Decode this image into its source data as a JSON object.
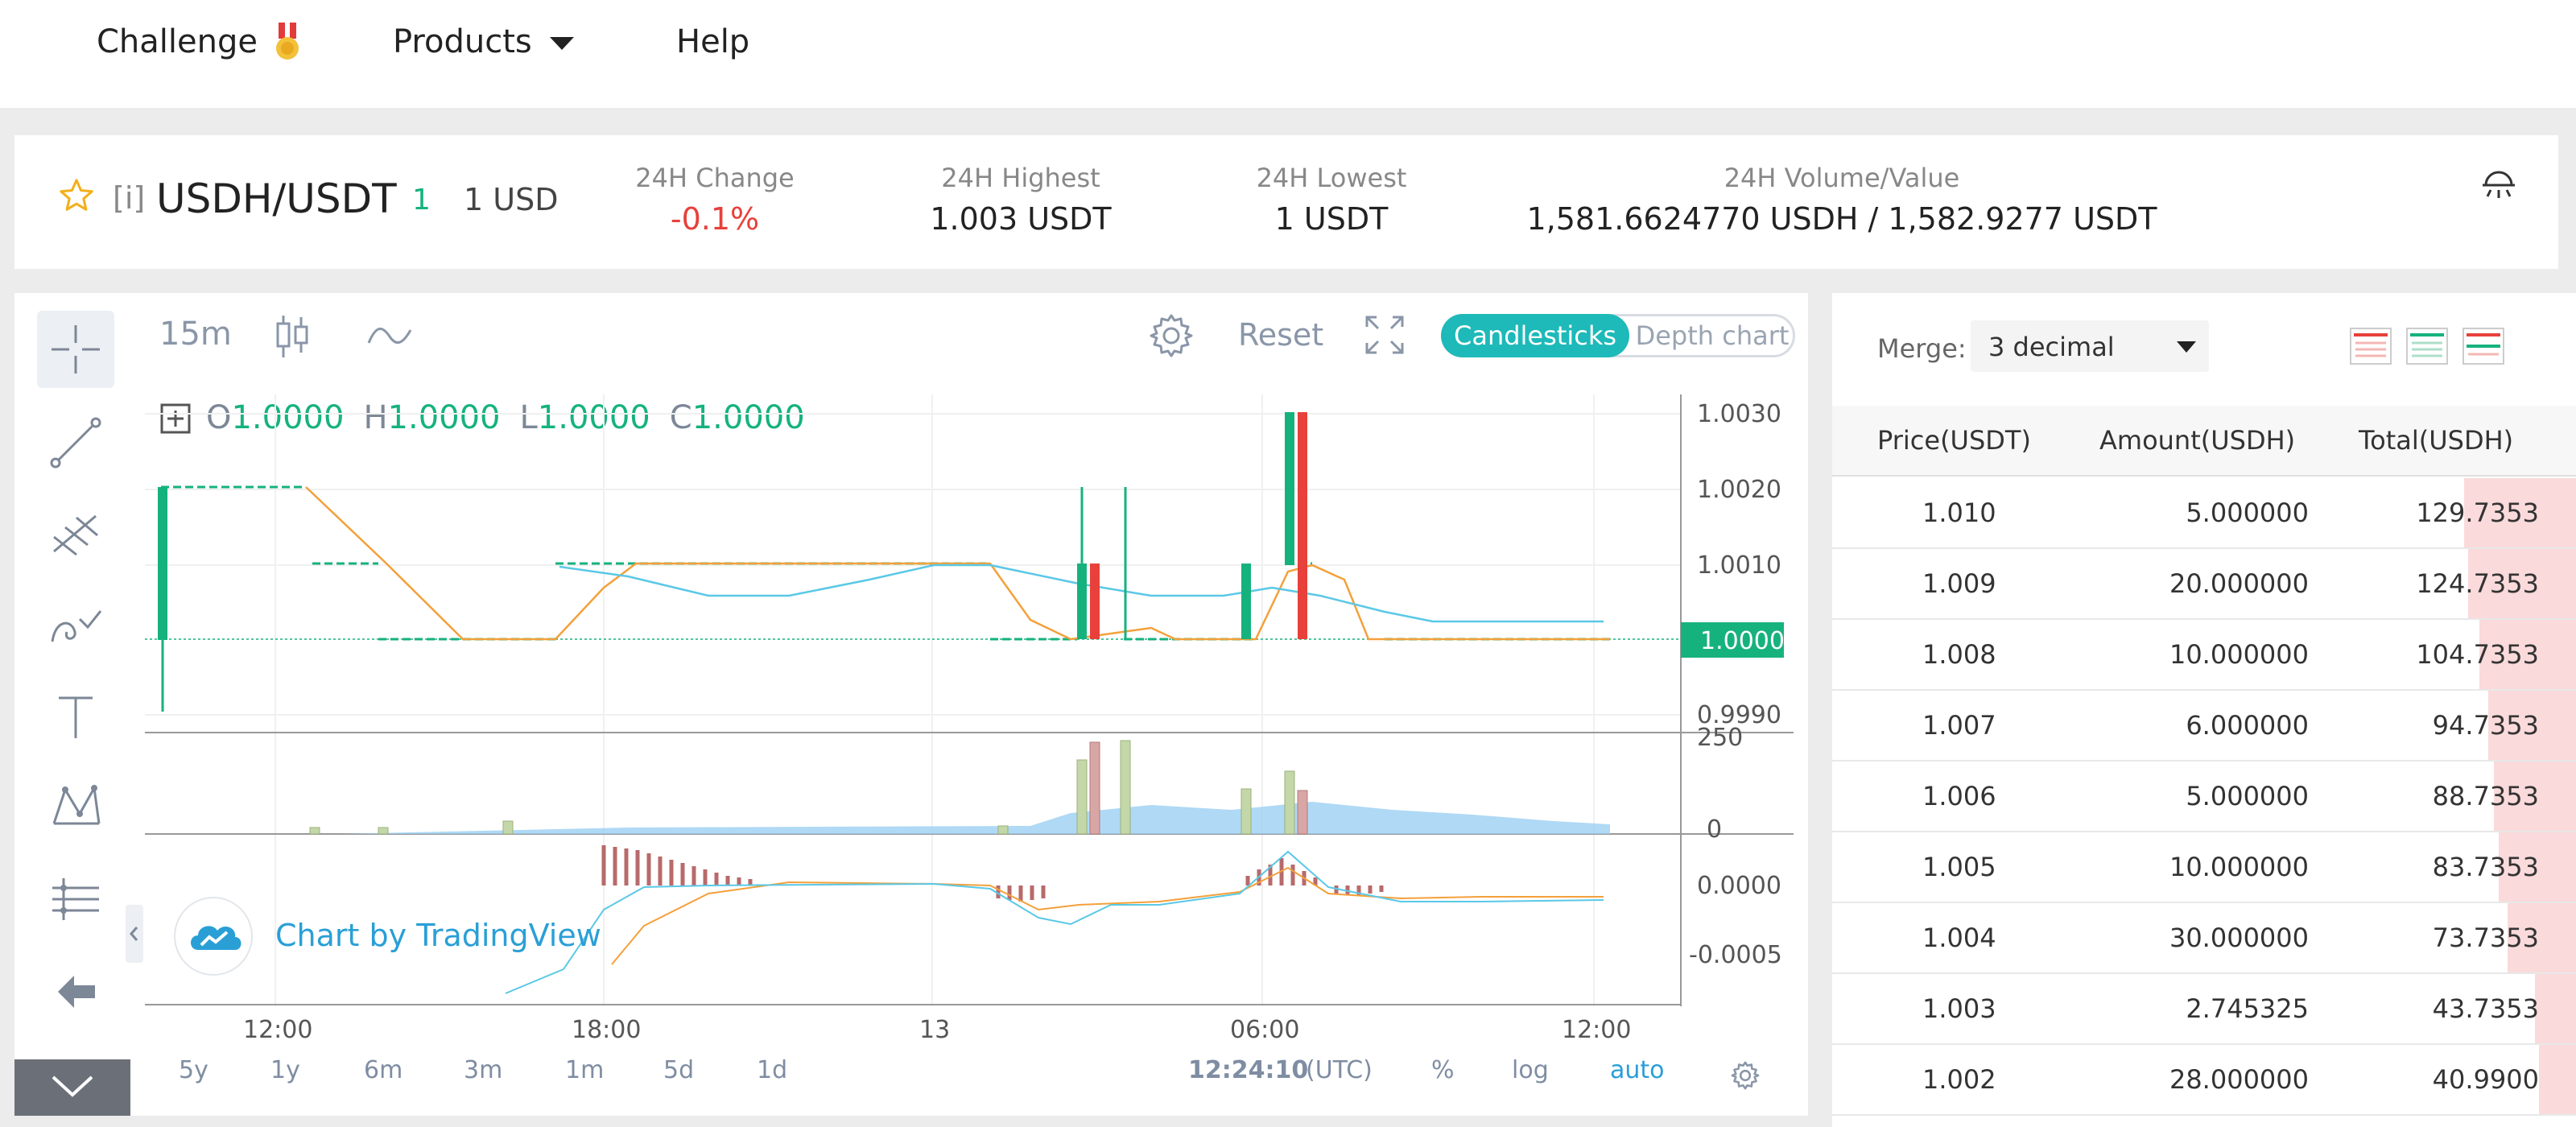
{
  "nav": {
    "challenge": "Challenge",
    "products": "Products",
    "help": "Help"
  },
  "ticker": {
    "bracket": "[i]",
    "pair": "USDH/USDT",
    "price": "1",
    "fiat": "1 USD",
    "stats": [
      {
        "label": "24H Change",
        "value": "-0.1%"
      },
      {
        "label": "24H Highest",
        "value": "1.003 USDT"
      },
      {
        "label": "24H Lowest",
        "value": "1 USDT"
      },
      {
        "label": "24H Volume/Value",
        "value": "1,581.6624770 USDH / 1,582.9277 USDT"
      }
    ],
    "colors": {
      "down": "#e8403a",
      "up": "#16b27e"
    }
  },
  "chart": {
    "interval": "15m",
    "reset": "Reset",
    "tabs": {
      "candlesticks": "Candlesticks",
      "depth": "Depth chart"
    },
    "ohlc": {
      "o_label": "O",
      "o": "1.0000",
      "h_label": "H",
      "h": "1.0000",
      "l_label": "L",
      "l": "1.0000",
      "c_label": "C",
      "c": "1.0000"
    },
    "price_ticks": [
      "1.0030",
      "1.0020",
      "1.0010",
      "0.9990"
    ],
    "last_price": "1.0000",
    "volume_ticks": [
      "250",
      "0"
    ],
    "macd_ticks": [
      "0.0000",
      "-0.0005"
    ],
    "time_ticks": [
      "12:00",
      "18:00",
      "13",
      "06:00",
      "12:00"
    ],
    "watermark": "Chart by TradingView",
    "ranges": [
      "5y",
      "1y",
      "6m",
      "3m",
      "1m",
      "5d",
      "1d"
    ],
    "clock": "12:24:10",
    "tz": "(UTC)",
    "scale_opts": {
      "percent": "%",
      "log": "log",
      "auto": "auto"
    }
  },
  "book": {
    "merge_label": "Merge:",
    "merge_value": "3 decimal",
    "headers": [
      "Price(USDT)",
      "Amount(USDH)",
      "Total(USDH)"
    ],
    "rows": [
      {
        "price": "1.010",
        "amount": "5.000000",
        "total": "129.7353",
        "depth": 0.15
      },
      {
        "price": "1.009",
        "amount": "20.000000",
        "total": "124.7353",
        "depth": 0.145
      },
      {
        "price": "1.008",
        "amount": "10.000000",
        "total": "104.7353",
        "depth": 0.13
      },
      {
        "price": "1.007",
        "amount": "6.000000",
        "total": "94.7353",
        "depth": 0.118
      },
      {
        "price": "1.006",
        "amount": "5.000000",
        "total": "88.7353",
        "depth": 0.11
      },
      {
        "price": "1.005",
        "amount": "10.000000",
        "total": "83.7353",
        "depth": 0.104
      },
      {
        "price": "1.004",
        "amount": "30.000000",
        "total": "73.7353",
        "depth": 0.092
      },
      {
        "price": "1.003",
        "amount": "2.745325",
        "total": "43.7353",
        "depth": 0.055
      },
      {
        "price": "1.002",
        "amount": "28.000000",
        "total": "40.9900",
        "depth": 0.05
      }
    ]
  }
}
